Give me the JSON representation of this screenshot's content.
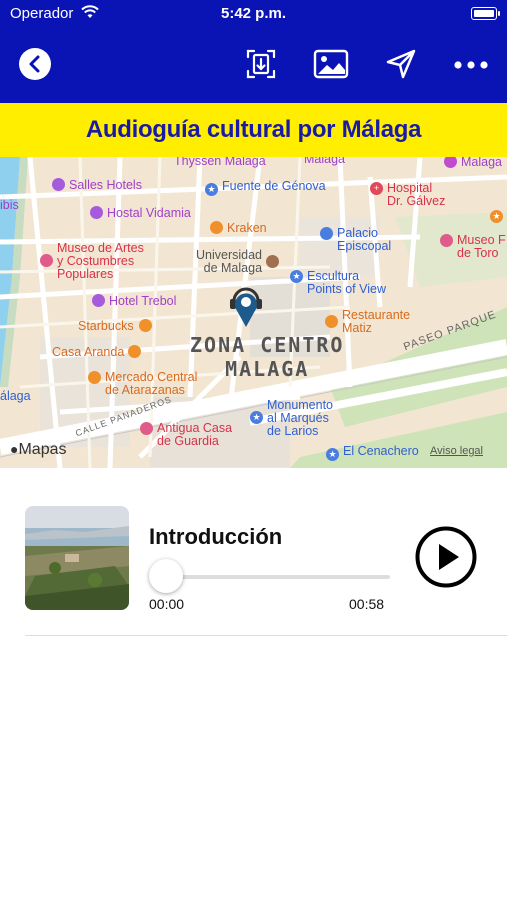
{
  "status": {
    "carrier": "Operador",
    "time": "5:42 p.m."
  },
  "toolbar": {
    "icons": [
      "back-icon",
      "fullscreen-icon",
      "image-icon",
      "location-arrow-icon",
      "more-icon"
    ]
  },
  "banner": {
    "title": "Audioguía cultural por Málaga"
  },
  "map": {
    "district": "ZONA CENTRO",
    "district2": "MALAGA",
    "street1": "PASEO PARQUE",
    "street2": "CALLE PANADEROS",
    "attribution_logo": "Mapas",
    "legal": "Aviso legal",
    "labels": {
      "thyssen": "Thyssen Malaga",
      "malaga_top": "Malaga",
      "malaga_top_right": "Malaga",
      "salles": "Salles Hotels",
      "fuente": "Fuente de Génova",
      "hospital": "Hospital\nDr. Gálvez",
      "ibis": "ibis",
      "vidamia": "Hostal Vidamia",
      "kraken": "Kraken",
      "palacio": "Palacio\nEpiscopal",
      "museo_artes": "Museo de Artes\ny Costumbres\nPopulares",
      "universidad": "Universidad\nde Malaga",
      "escultura": "Escultura\nPoints of View",
      "museo_toro": "Museo F\nde Toro",
      "trebol": "Hotel Trebol",
      "starbucks": "Starbucks",
      "restaurante": "Restaurante\nMatiz",
      "aranda": "Casa Aranda",
      "mercado": "Mercado Central\nde Atarazanas",
      "alaga": "álaga",
      "monumento": "Monumento\nal Marqués\nde Larios",
      "antigua": "Antigua Casa\nde Guardia",
      "cenachero": "El Cenachero"
    }
  },
  "track": {
    "title": "Introducción",
    "progress": 0,
    "time_current": "00:00",
    "time_total": "00:58"
  },
  "colors": {
    "nav": "#0a14b4",
    "banner": "#ffee00",
    "banner_text": "#1a1aa8",
    "pin": "#1c5b8c"
  }
}
